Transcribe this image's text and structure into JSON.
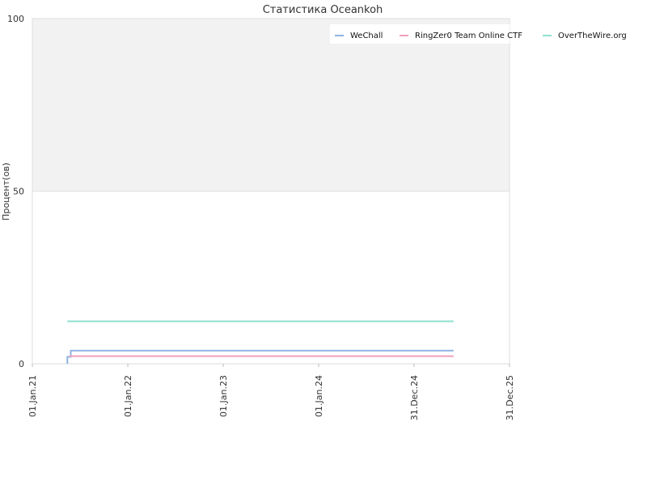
{
  "chart_data": {
    "type": "line",
    "title": "Статистика Oceankoh",
    "xlabel": "",
    "ylabel": "Процент(ов)",
    "ylim": [
      0,
      100
    ],
    "xlim": [
      "2021-01-01",
      "2025-12-31"
    ],
    "y_ticks": [
      "0",
      "50",
      "100"
    ],
    "x_ticks": [
      {
        "label": "01.Jan.21",
        "date": "2021-01-01"
      },
      {
        "label": "01.Jan.22",
        "date": "2022-01-01"
      },
      {
        "label": "01.Jan.23",
        "date": "2023-01-01"
      },
      {
        "label": "01.Jan.24",
        "date": "2024-01-01"
      },
      {
        "label": "31.Dec.24",
        "date": "2024-12-31"
      },
      {
        "label": "31.Dec.25",
        "date": "2025-12-31"
      }
    ],
    "grid": true,
    "shaded_band": [
      50,
      100
    ],
    "legend_position": "top-right",
    "series": [
      {
        "name": "WeChall",
        "color": "#8eb4e3",
        "points": [
          {
            "x": "2021-05-15",
            "y": 0
          },
          {
            "x": "2021-05-15",
            "y": 2
          },
          {
            "x": "2021-05-28",
            "y": 2
          },
          {
            "x": "2021-05-28",
            "y": 3.8
          },
          {
            "x": "2025-05-31",
            "y": 3.8
          }
        ]
      },
      {
        "name": "RingZer0 Team Online CTF",
        "color": "#f0a0bc",
        "points": [
          {
            "x": "2021-05-22",
            "y": 2.2
          },
          {
            "x": "2025-05-31",
            "y": 2.2
          }
        ]
      },
      {
        "name": "OverTheWire.org",
        "color": "#8fe0cf",
        "points": [
          {
            "x": "2021-05-15",
            "y": 12.3
          },
          {
            "x": "2025-05-31",
            "y": 12.3
          }
        ]
      }
    ]
  }
}
